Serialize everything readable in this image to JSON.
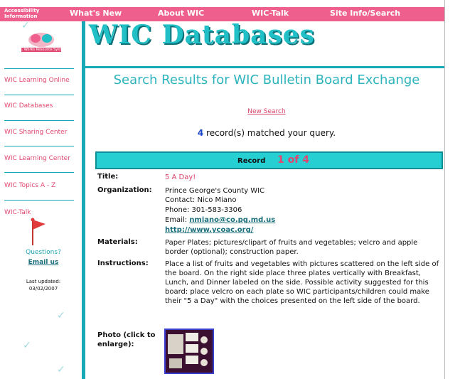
{
  "nav": {
    "accessibility": "Accessibility Information",
    "whats_new": "What's New",
    "about": "About WIC",
    "talk": "WIC-Talk",
    "site_info": "Site Info/Search"
  },
  "sidebar": {
    "logo_text": "WIC Works Resource System",
    "items": [
      {
        "label": "WIC Learning Online"
      },
      {
        "label": "WIC Databases"
      },
      {
        "label": "WIC Sharing Center"
      },
      {
        "label": "WIC Learning Center"
      },
      {
        "label": "WIC Topics A - Z"
      },
      {
        "label": "WIC-Talk"
      }
    ],
    "questions": "Questions?",
    "email_us": "Email us",
    "last_updated_label": "Last updated:",
    "last_updated": "03/02/2007"
  },
  "main": {
    "banner": "WIC Databases",
    "results_title": "Search Results for WIC Bulletin Board Exchange",
    "new_search": "New Search",
    "match_count": "4",
    "match_text": "record(s) matched your query.",
    "record_label": "Record",
    "record_count": "1 of 4",
    "fields": {
      "title_label": "Title:",
      "title": "5 A Day!",
      "org_label": "Organization:",
      "org_name": "Prince George's County WIC",
      "contact": "Contact: Nico Miano",
      "phone": "Phone: 301-583-3306",
      "email_label": "Email:",
      "email": "nmiano@co.pg.md.us",
      "url": "http://www.ycoac.org/",
      "materials_label": "Materials:",
      "materials": "Paper Plates; pictures/clipart of fruits and vegetables; velcro and apple border (optional); construction paper.",
      "instructions_label": "Instructions:",
      "instructions": "Place a list of fruits and vegetables with pictures scattered on the left side of the board. On the right side place three plates vertically with Breakfast, Lunch, and Dinner labeled on the side. Possible activity suggested for this board: place velcro on each plate so WIC participants/children could make their \"5 a Day\" with the choices presented on the left side of the board.",
      "photo_label": "Photo (click to enlarge):"
    }
  },
  "colors": {
    "nav_pink": "#ee5f8e",
    "teal": "#18a9b6",
    "banner_teal": "#21c0c6",
    "record_bar": "#26cfd2",
    "link_pink": "#d8436a"
  }
}
